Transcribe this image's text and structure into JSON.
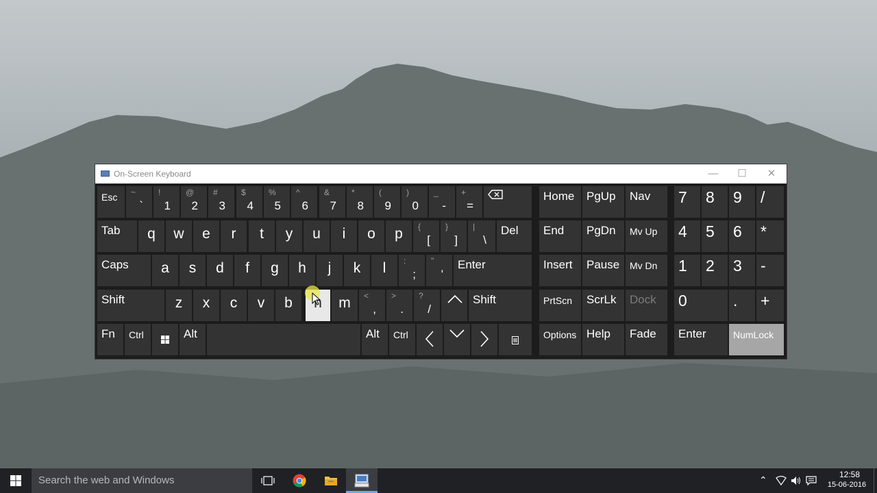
{
  "window": {
    "title": "On-Screen Keyboard"
  },
  "colors": {
    "key": "#333333",
    "key_pressed": "#e8e8e8",
    "key_active": "#a6a6a6",
    "taskbar": "#1f2125"
  },
  "keys": {
    "esc": "Esc",
    "tilde": {
      "shift": "~",
      "base": "`"
    },
    "d1": {
      "shift": "!",
      "base": "1"
    },
    "d2": {
      "shift": "@",
      "base": "2"
    },
    "d3": {
      "shift": "#",
      "base": "3"
    },
    "d4": {
      "shift": "$",
      "base": "4"
    },
    "d5": {
      "shift": "%",
      "base": "5"
    },
    "d6": {
      "shift": "^",
      "base": "6"
    },
    "d7": {
      "shift": "&",
      "base": "7"
    },
    "d8": {
      "shift": "*",
      "base": "8"
    },
    "d9": {
      "shift": "(",
      "base": "9"
    },
    "d0": {
      "shift": ")",
      "base": "0"
    },
    "minus": {
      "shift": "_",
      "base": "-"
    },
    "equals": {
      "shift": "+",
      "base": "="
    },
    "tab": "Tab",
    "q": "q",
    "w": "w",
    "e": "e",
    "r": "r",
    "t": "t",
    "y": "y",
    "u": "u",
    "i": "i",
    "o": "o",
    "p": "p",
    "lbracket": {
      "shift": "{",
      "base": "["
    },
    "rbracket": {
      "shift": "}",
      "base": "]"
    },
    "backslash": {
      "shift": "|",
      "base": "\\"
    },
    "del": "Del",
    "caps": "Caps",
    "a": "a",
    "s": "s",
    "d": "d",
    "f": "f",
    "g": "g",
    "h": "h",
    "j": "j",
    "k": "k",
    "l": "l",
    "semicolon": {
      "shift": ":",
      "base": ";"
    },
    "quote": {
      "shift": "\"",
      "base": "'"
    },
    "enter": "Enter",
    "shift_left": "Shift",
    "z": "z",
    "x": "x",
    "c": "c",
    "v": "v",
    "b": "b",
    "n": "n",
    "m": "m",
    "comma": {
      "shift": "<",
      "base": ","
    },
    "period": {
      "shift": ">",
      "base": "."
    },
    "slash": {
      "shift": "?",
      "base": "/"
    },
    "shift_right": "Shift",
    "fn": "Fn",
    "ctrl_left": "Ctrl",
    "alt_left": "Alt",
    "alt_right": "Alt",
    "ctrl_right": "Ctrl",
    "home": "Home",
    "pgup": "PgUp",
    "nav": "Nav",
    "end": "End",
    "pgdn": "PgDn",
    "mvup": "Mv Up",
    "insert": "Insert",
    "pause": "Pause",
    "mvdn": "Mv Dn",
    "prtscn": "PrtScn",
    "scrlk": "ScrLk",
    "dock": "Dock",
    "options": "Options",
    "help": "Help",
    "fade": "Fade",
    "np7": "7",
    "np8": "8",
    "np9": "9",
    "npdiv": "/",
    "np4": "4",
    "np5": "5",
    "np6": "6",
    "npmul": "*",
    "np1": "1",
    "np2": "2",
    "np3": "3",
    "npsub": "-",
    "np0": "0",
    "npdot": ".",
    "npadd": "+",
    "npenter": "Enter",
    "numlock": "NumLock"
  },
  "taskbar": {
    "search_placeholder": "Search the web and Windows",
    "time": "12:58",
    "date": "15-06-2016"
  }
}
